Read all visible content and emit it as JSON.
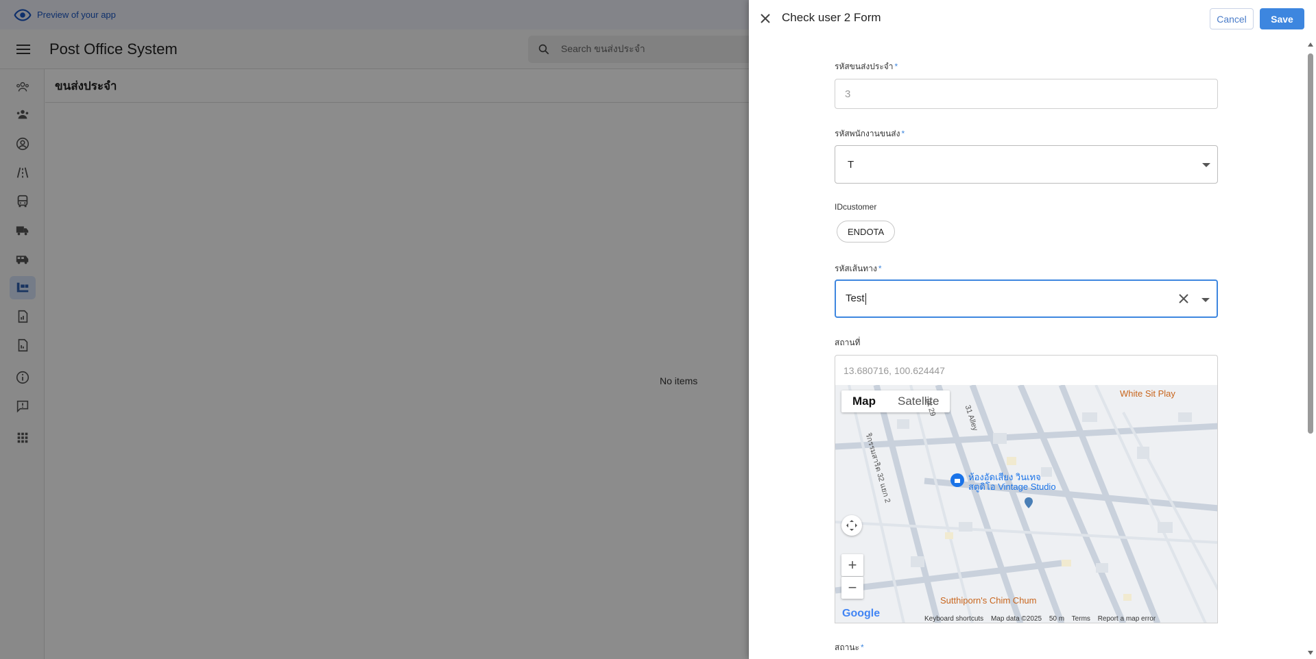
{
  "preview": {
    "text": "Preview of your app"
  },
  "app": {
    "title": "Post Office System",
    "search_placeholder": "Search ขนส่งประจำ"
  },
  "main": {
    "heading": "ขนส่งประจำ",
    "empty": "No items"
  },
  "drawer": {
    "title": "Check user 2 Form",
    "cancel": "Cancel",
    "save": "Save",
    "fields": {
      "f1_label": "รหัสขนส่งประจำ",
      "f1_value": "3",
      "f2_label": "รหัสพนักงานขนส่ง",
      "f2_value": "T",
      "f3_label": "IDcustomer",
      "f3_chip": "ENDOTA",
      "f4_label": "รหัสเส้นทาง",
      "f4_value": "Test",
      "f5_label": "สถานที่",
      "f5_value": "13.680716, 100.624447",
      "f6_label": "สถานะ",
      "required_mark": "*"
    }
  },
  "map": {
    "tab_map": "Map",
    "tab_satellite": "Satellite",
    "poi_line1": "ห้องอัดเสียง วินเทจ",
    "poi_line2": "สตูดิโอ Vintage Studio",
    "place_white_sit": "White Sit Play",
    "place_sutthiporn": "Sutthiporn's Chim Chum",
    "street_alley": "31 Alley",
    "street_soi": "ริกรรมสาริต 32 แยก 2",
    "street_29": "uk 29",
    "logo": "Google",
    "keyboard": "Keyboard shortcuts",
    "map_data": "Map data ©2025",
    "scale": "50 m",
    "terms": "Terms",
    "report": "Report a map error"
  },
  "sidebar_icons": [
    "groups-icon",
    "group-icon",
    "account-circle-icon",
    "road-icon",
    "bus-icon",
    "truck-icon",
    "van-icon",
    "conveyor-icon",
    "report-icon",
    "document-icon",
    "info-icon",
    "feedback-icon",
    "apps-icon"
  ],
  "colors": {
    "accent": "#3d86df",
    "preview_text": "#1a56c4",
    "overlay": "rgba(0,0,0,0.45)"
  }
}
